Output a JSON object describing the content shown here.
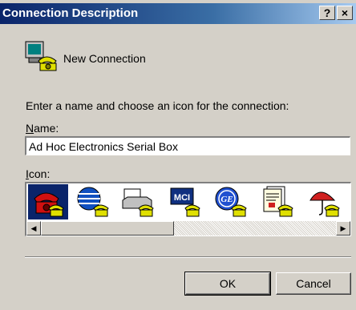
{
  "window": {
    "title": "Connection Description",
    "help_label": "?",
    "close_label": "×"
  },
  "header": {
    "label": "New Connection",
    "icon": "phone-computer-icon"
  },
  "prompt": "Enter a name and choose an icon for the connection:",
  "name": {
    "label": "Name:",
    "label_accel": "N",
    "label_rest": "ame:",
    "value": "Ad Hoc Electronics Serial Box"
  },
  "icon_picker": {
    "label_accel": "I",
    "label_rest": "con:",
    "icons": [
      {
        "name": "red-phone-icon",
        "selected": true
      },
      {
        "name": "globe-phone-icon",
        "selected": false
      },
      {
        "name": "fax-phone-icon",
        "selected": false
      },
      {
        "name": "mci-phone-icon",
        "selected": false,
        "text": "MCI"
      },
      {
        "name": "ge-phone-icon",
        "selected": false,
        "text": "GE"
      },
      {
        "name": "document-phone-icon",
        "selected": false
      },
      {
        "name": "umbrella-phone-icon",
        "selected": false
      }
    ]
  },
  "buttons": {
    "ok": "OK",
    "cancel": "Cancel"
  },
  "colors": {
    "titlebar": "#0a246a",
    "dialog": "#d4d0c8",
    "selection": "#0a246a"
  }
}
